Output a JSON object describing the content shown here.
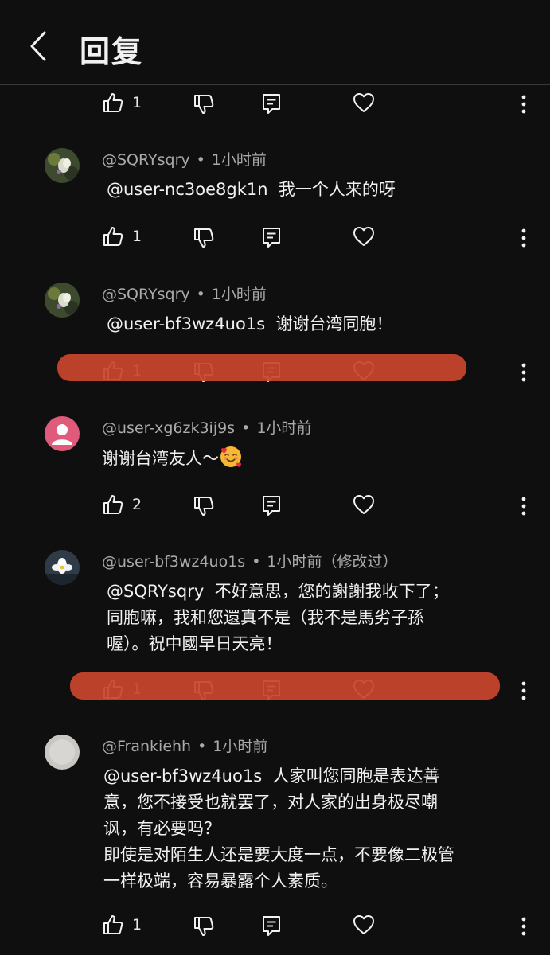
{
  "header": {
    "title": "回复",
    "back_icon": "chevron-left-icon"
  },
  "theme": {
    "background": "#0f0f0f",
    "text": "#f1f1f1",
    "secondary": "#aaaaaa",
    "redaction": "#c9452c"
  },
  "top_actions": {
    "like_count": "1"
  },
  "comments": [
    {
      "handle": "@SQRYsqry",
      "sep": "•",
      "time": "1小时前",
      "edited": "",
      "text": "@user-nc3oe8gk1n  我一个人来的呀",
      "like_count": "1"
    },
    {
      "handle": "@SQRYsqry",
      "sep": "•",
      "time": "1小时前",
      "edited": "",
      "text": "@user-bf3wz4uo1s  谢谢台湾同胞！",
      "like_count": "1"
    },
    {
      "handle": "@user-xg6zk3ij9s",
      "sep": "•",
      "time": "1小时前",
      "edited": "",
      "text": "谢谢台湾友人～",
      "emoji": "smiling-face-with-hearts",
      "like_count": "2"
    },
    {
      "handle": "@user-bf3wz4uo1s",
      "sep": "•",
      "time": "1小时前",
      "edited": "（修改过）",
      "text": "@SQRYsqry  不好意思，您的謝謝我收下了；\n同胞嘛，我和您還真不是（我不是馬劣子孫\n喔）。祝中國早日天亮！",
      "like_count": "1"
    },
    {
      "handle": "@Frankiehh",
      "sep": "•",
      "time": "1小时前",
      "edited": "",
      "text": "@user-bf3wz4uo1s  人家叫您同胞是表达善\n意，您不接受也就罢了，对人家的出身极尽嘲\n讽，有必要吗？\n即使是对陌生人还是要大度一点，不要像二极管\n一样极端，容易暴露个人素质。",
      "like_count": "1"
    }
  ]
}
